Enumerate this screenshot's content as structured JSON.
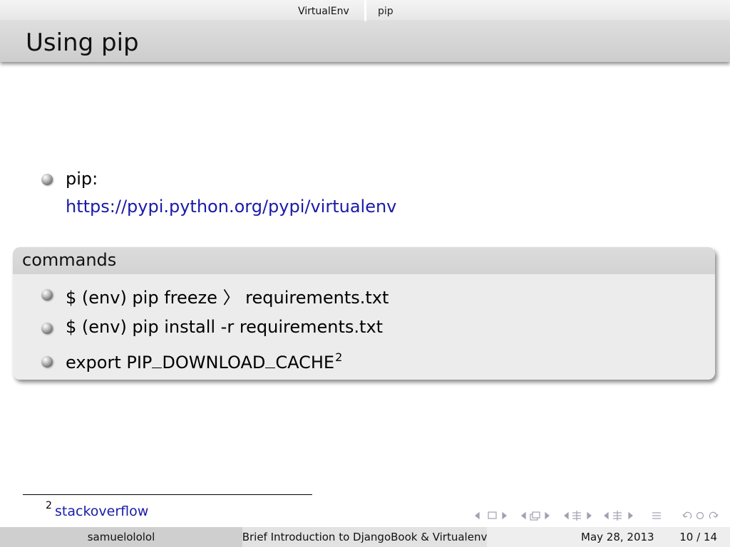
{
  "headline": {
    "sections": [
      {
        "label": "VirtualEnv",
        "active": true
      },
      {
        "label": "pip",
        "active": false
      }
    ]
  },
  "frame": {
    "title": "Using pip"
  },
  "items": [
    {
      "label": "pip:",
      "link": "https://pypi.python.org/pypi/virtualenv"
    }
  ],
  "block": {
    "title": "commands",
    "items": [
      {
        "text": "$ (env) pip freeze 〉 requirements.txt"
      },
      {
        "text": "$ (env) pip install -r requirements.txt"
      },
      {
        "text_before": "export PIP",
        "text_mid_1": "DOWNLOAD",
        "text_mid_2": "CACHE",
        "footnote_mark": "2"
      }
    ]
  },
  "footnote": {
    "mark": "2",
    "text": "stackoverflow"
  },
  "footline": {
    "author": "samuelololol",
    "title": "Brief Introduction to DjangoBook & Virtualenv",
    "date": "May 28, 2013",
    "page": "10 / 14"
  },
  "nav": {
    "icons": [
      "frame-back-icon",
      "frame-icon",
      "frame-forward-icon",
      "subsection-back-icon",
      "subsection-icon",
      "subsection-forward-icon",
      "section-back-icon",
      "section-icon",
      "section-forward-icon",
      "subsection2-back-icon",
      "subsection2-icon",
      "subsection2-forward-icon",
      "document-icon",
      "undo-icon",
      "search-icon",
      "redo-icon"
    ]
  }
}
